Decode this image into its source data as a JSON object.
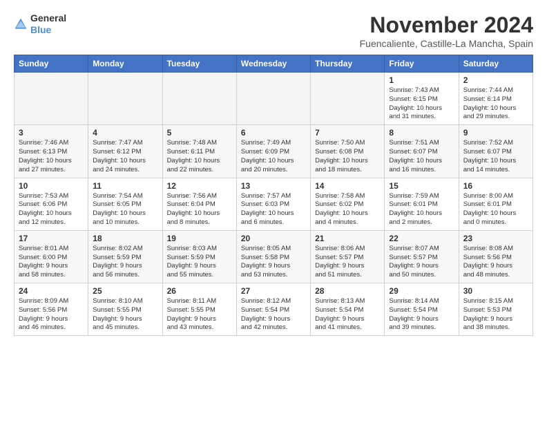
{
  "header": {
    "logo_general": "General",
    "logo_blue": "Blue",
    "month_title": "November 2024",
    "subtitle": "Fuencaliente, Castille-La Mancha, Spain"
  },
  "days_of_week": [
    "Sunday",
    "Monday",
    "Tuesday",
    "Wednesday",
    "Thursday",
    "Friday",
    "Saturday"
  ],
  "weeks": [
    [
      {
        "day": "",
        "info": ""
      },
      {
        "day": "",
        "info": ""
      },
      {
        "day": "",
        "info": ""
      },
      {
        "day": "",
        "info": ""
      },
      {
        "day": "",
        "info": ""
      },
      {
        "day": "1",
        "info": "Sunrise: 7:43 AM\nSunset: 6:15 PM\nDaylight: 10 hours\nand 31 minutes."
      },
      {
        "day": "2",
        "info": "Sunrise: 7:44 AM\nSunset: 6:14 PM\nDaylight: 10 hours\nand 29 minutes."
      }
    ],
    [
      {
        "day": "3",
        "info": "Sunrise: 7:46 AM\nSunset: 6:13 PM\nDaylight: 10 hours\nand 27 minutes."
      },
      {
        "day": "4",
        "info": "Sunrise: 7:47 AM\nSunset: 6:12 PM\nDaylight: 10 hours\nand 24 minutes."
      },
      {
        "day": "5",
        "info": "Sunrise: 7:48 AM\nSunset: 6:11 PM\nDaylight: 10 hours\nand 22 minutes."
      },
      {
        "day": "6",
        "info": "Sunrise: 7:49 AM\nSunset: 6:09 PM\nDaylight: 10 hours\nand 20 minutes."
      },
      {
        "day": "7",
        "info": "Sunrise: 7:50 AM\nSunset: 6:08 PM\nDaylight: 10 hours\nand 18 minutes."
      },
      {
        "day": "8",
        "info": "Sunrise: 7:51 AM\nSunset: 6:07 PM\nDaylight: 10 hours\nand 16 minutes."
      },
      {
        "day": "9",
        "info": "Sunrise: 7:52 AM\nSunset: 6:07 PM\nDaylight: 10 hours\nand 14 minutes."
      }
    ],
    [
      {
        "day": "10",
        "info": "Sunrise: 7:53 AM\nSunset: 6:06 PM\nDaylight: 10 hours\nand 12 minutes."
      },
      {
        "day": "11",
        "info": "Sunrise: 7:54 AM\nSunset: 6:05 PM\nDaylight: 10 hours\nand 10 minutes."
      },
      {
        "day": "12",
        "info": "Sunrise: 7:56 AM\nSunset: 6:04 PM\nDaylight: 10 hours\nand 8 minutes."
      },
      {
        "day": "13",
        "info": "Sunrise: 7:57 AM\nSunset: 6:03 PM\nDaylight: 10 hours\nand 6 minutes."
      },
      {
        "day": "14",
        "info": "Sunrise: 7:58 AM\nSunset: 6:02 PM\nDaylight: 10 hours\nand 4 minutes."
      },
      {
        "day": "15",
        "info": "Sunrise: 7:59 AM\nSunset: 6:01 PM\nDaylight: 10 hours\nand 2 minutes."
      },
      {
        "day": "16",
        "info": "Sunrise: 8:00 AM\nSunset: 6:01 PM\nDaylight: 10 hours\nand 0 minutes."
      }
    ],
    [
      {
        "day": "17",
        "info": "Sunrise: 8:01 AM\nSunset: 6:00 PM\nDaylight: 9 hours\nand 58 minutes."
      },
      {
        "day": "18",
        "info": "Sunrise: 8:02 AM\nSunset: 5:59 PM\nDaylight: 9 hours\nand 56 minutes."
      },
      {
        "day": "19",
        "info": "Sunrise: 8:03 AM\nSunset: 5:59 PM\nDaylight: 9 hours\nand 55 minutes."
      },
      {
        "day": "20",
        "info": "Sunrise: 8:05 AM\nSunset: 5:58 PM\nDaylight: 9 hours\nand 53 minutes."
      },
      {
        "day": "21",
        "info": "Sunrise: 8:06 AM\nSunset: 5:57 PM\nDaylight: 9 hours\nand 51 minutes."
      },
      {
        "day": "22",
        "info": "Sunrise: 8:07 AM\nSunset: 5:57 PM\nDaylight: 9 hours\nand 50 minutes."
      },
      {
        "day": "23",
        "info": "Sunrise: 8:08 AM\nSunset: 5:56 PM\nDaylight: 9 hours\nand 48 minutes."
      }
    ],
    [
      {
        "day": "24",
        "info": "Sunrise: 8:09 AM\nSunset: 5:56 PM\nDaylight: 9 hours\nand 46 minutes."
      },
      {
        "day": "25",
        "info": "Sunrise: 8:10 AM\nSunset: 5:55 PM\nDaylight: 9 hours\nand 45 minutes."
      },
      {
        "day": "26",
        "info": "Sunrise: 8:11 AM\nSunset: 5:55 PM\nDaylight: 9 hours\nand 43 minutes."
      },
      {
        "day": "27",
        "info": "Sunrise: 8:12 AM\nSunset: 5:54 PM\nDaylight: 9 hours\nand 42 minutes."
      },
      {
        "day": "28",
        "info": "Sunrise: 8:13 AM\nSunset: 5:54 PM\nDaylight: 9 hours\nand 41 minutes."
      },
      {
        "day": "29",
        "info": "Sunrise: 8:14 AM\nSunset: 5:54 PM\nDaylight: 9 hours\nand 39 minutes."
      },
      {
        "day": "30",
        "info": "Sunrise: 8:15 AM\nSunset: 5:53 PM\nDaylight: 9 hours\nand 38 minutes."
      }
    ]
  ]
}
